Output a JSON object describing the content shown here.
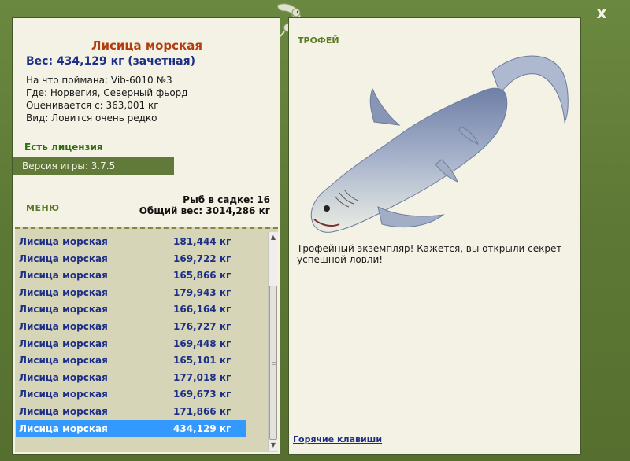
{
  "close_label": "x",
  "catch": {
    "title": "Лисица морская",
    "weight": "Вес: 434,129 кг (зачетная)",
    "info": [
      "На что поймана: Vib-6010 №3",
      "Где: Норвегия, Северный фьорд",
      "Оценивается с: 363,001 кг",
      "Вид: Ловится очень редко"
    ]
  },
  "license": "Есть лицензия",
  "version": "Версия игры: 3.7.5",
  "menu_label": "МЕНЮ",
  "stats": {
    "fish_count": "Рыб в садке: 16",
    "total_weight": "Общий вес: 3014,286 кг"
  },
  "catch_list": [
    {
      "name": "Лисица морская",
      "weight": "181,444 кг"
    },
    {
      "name": "Лисица морская",
      "weight": "169,722 кг"
    },
    {
      "name": "Лисица морская",
      "weight": "165,866 кг"
    },
    {
      "name": "Лисица морская",
      "weight": "179,943 кг"
    },
    {
      "name": "Лисица морская",
      "weight": "166,164 кг"
    },
    {
      "name": "Лисица морская",
      "weight": "176,727 кг"
    },
    {
      "name": "Лисица морская",
      "weight": "169,448 кг"
    },
    {
      "name": "Лисица морская",
      "weight": "165,101 кг"
    },
    {
      "name": "Лисица морская",
      "weight": "177,018 кг"
    },
    {
      "name": "Лисица морская",
      "weight": "169,673 кг"
    },
    {
      "name": "Лисица морская",
      "weight": "171,866 кг"
    },
    {
      "name": "Лисица морская",
      "weight": "434,129 кг"
    }
  ],
  "selected_index": 11,
  "trophy": {
    "title": "ТРОФЕЙ",
    "text": "Трофейный экземпляр! Кажется, вы открыли секрет успешной ловли!"
  },
  "hotkeys_label": "Горячие клавиши",
  "icons": {
    "close": "close-icon",
    "logo": "lizard-logo-icon",
    "fish": "thresher-shark-image"
  },
  "colors": {
    "frame": "#5f7a37",
    "panel": "#f4f2e4",
    "title": "#b13d10",
    "value_text": "#1d2f86",
    "selection": "#3399ff",
    "accent_green": "#5b7a25"
  }
}
